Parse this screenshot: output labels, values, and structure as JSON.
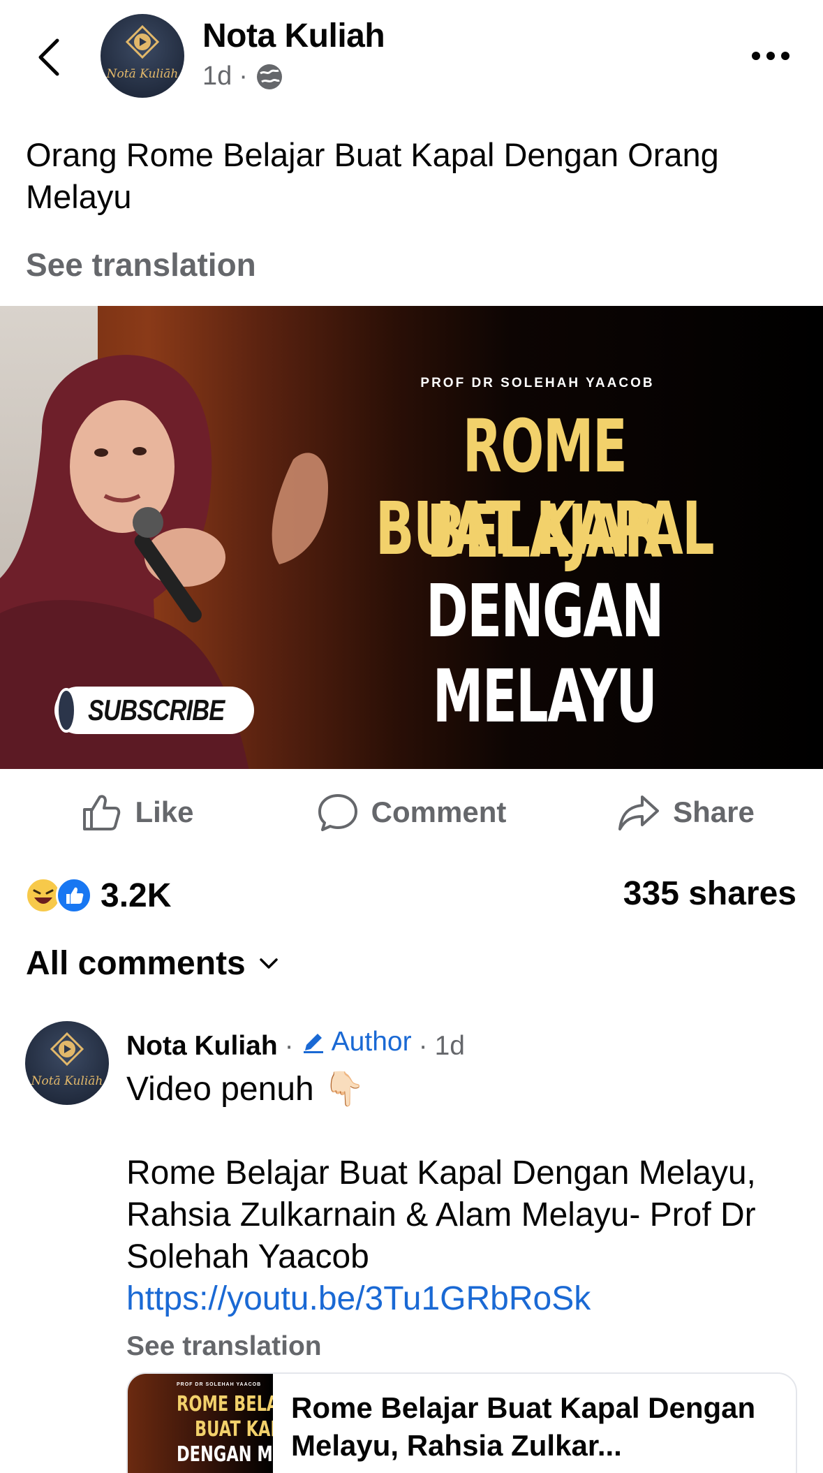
{
  "header": {
    "page_name": "Nota Kuliah",
    "time": "1d",
    "separator": "·",
    "logo_text": "Notā Kuliāh"
  },
  "post": {
    "text": "Orang Rome Belajar Buat Kapal Dengan Orang Melayu",
    "see_translation": "See translation"
  },
  "thumbnail": {
    "subtitle": "PROF DR SOLEHAH YAACOB",
    "line1": "ROME BELAJAR",
    "line2": "BUAT KAPAL",
    "line3": "DENGAN MELAYU",
    "subscribe": "SUBSCRIBE"
  },
  "actions": {
    "like": "Like",
    "comment": "Comment",
    "share": "Share"
  },
  "reactions": {
    "count": "3.2K",
    "shares": "335 shares"
  },
  "comments": {
    "filter_label": "All comments",
    "items": [
      {
        "name": "Nota Kuliah",
        "dot": "·",
        "badge": "Author",
        "time": "1d",
        "line1": "Video penuh 👇🏻",
        "line2": "Rome Belajar Buat Kapal  Dengan Melayu, Rahsia Zulkarnain & Alam Melayu- Prof Dr Solehah Yaacob",
        "link": "https://youtu.be/3Tu1GRbRoSk",
        "see_translation": "See translation",
        "preview_title": "Rome Belajar Buat Kapal Dengan Melayu, Rahsia Zulkar..."
      }
    ]
  },
  "preview_thumb": {
    "subtitle": "PROF DR SOLEHAH YAACOB",
    "line1": "ROME BELAJ",
    "line2": "BUAT KAP",
    "line3": "DENGAN MEL"
  },
  "colors": {
    "link_blue": "#1a69d4",
    "muted_gray": "#65676b",
    "title_yellow": "#f2d16b",
    "logo_gold": "#e2b86a"
  }
}
